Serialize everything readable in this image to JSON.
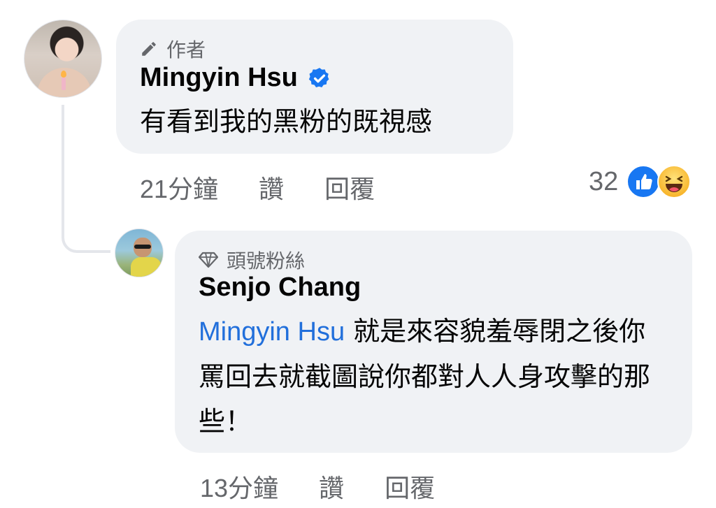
{
  "comment": {
    "author_badge": "作者",
    "author_name": "Mingyin Hsu",
    "text": "有看到我的黑粉的既視感",
    "timestamp": "21分鐘",
    "like_label": "讚",
    "reply_label": "回覆",
    "reaction_count": "32",
    "reactions": [
      "like-icon",
      "haha-icon"
    ]
  },
  "reply": {
    "author_badge": "頭號粉絲",
    "author_name": "Senjo Chang",
    "mention": "Mingyin Hsu",
    "text": "就是來容貌羞辱閉之後你罵回去就截圖說你都對人人身攻擊的那些！",
    "timestamp": "13分鐘",
    "like_label": "讚",
    "reply_label": "回覆"
  },
  "colors": {
    "bubble": "#f0f2f5",
    "secondary_text": "#65676b",
    "mention": "#216fdb",
    "verified": "#1877f2"
  }
}
